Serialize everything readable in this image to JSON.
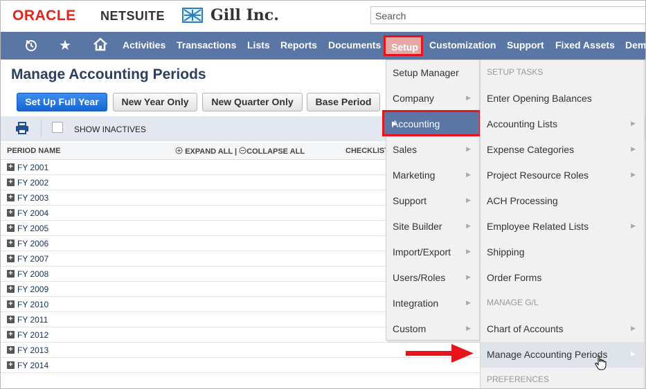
{
  "header": {
    "brand_oracle": "ORACLE",
    "brand_netsuite": "NETSUITE",
    "company_name": "Gill Inc.",
    "search_placeholder": "Search"
  },
  "nav": {
    "icons": [
      "recent-history-icon",
      "star-icon",
      "home-icon"
    ],
    "items": [
      "Activities",
      "Transactions",
      "Lists",
      "Reports",
      "Documents",
      "Setup",
      "Customization",
      "Support",
      "Fixed Assets",
      "Dem"
    ],
    "active": "Setup"
  },
  "page": {
    "title": "Manage Accounting Periods",
    "buttons": [
      "Set Up Full Year",
      "New Year Only",
      "New Quarter Only",
      "Base Period"
    ],
    "show_inactives": "SHOW INACTIVES",
    "table": {
      "col_period_name": "PERIOD NAME",
      "expand_all": "EXPAND ALL",
      "divider": "|",
      "collapse_all": "COLLAPSE ALL",
      "col_checklist": "CHECKLIST",
      "rows": [
        "FY 2001",
        "FY 2002",
        "FY 2003",
        "FY 2004",
        "FY 2005",
        "FY 2006",
        "FY 2007",
        "FY 2008",
        "FY 2009",
        "FY 2010",
        "FY 2011",
        "FY 2012",
        "FY 2013",
        "FY 2014"
      ]
    }
  },
  "setup_menu": {
    "items": [
      "Setup Manager",
      "Company",
      "Accounting",
      "Sales",
      "Marketing",
      "Support",
      "Site Builder",
      "Import/Export",
      "Users/Roles",
      "Integration",
      "Custom"
    ],
    "with_submenu": [
      false,
      true,
      true,
      true,
      true,
      true,
      true,
      true,
      true,
      true,
      true
    ],
    "selected": "Accounting"
  },
  "accounting_submenu": {
    "items": [
      {
        "label": "SETUP TASKS",
        "section": true,
        "arrow": false
      },
      {
        "label": "Enter Opening Balances",
        "section": false,
        "arrow": false
      },
      {
        "label": "Accounting Lists",
        "section": false,
        "arrow": true
      },
      {
        "label": "Expense Categories",
        "section": false,
        "arrow": true
      },
      {
        "label": "Project Resource Roles",
        "section": false,
        "arrow": true
      },
      {
        "label": "ACH Processing",
        "section": false,
        "arrow": false
      },
      {
        "label": "Employee Related Lists",
        "section": false,
        "arrow": true
      },
      {
        "label": "Shipping",
        "section": false,
        "arrow": false
      },
      {
        "label": "Order Forms",
        "section": false,
        "arrow": false
      },
      {
        "label": "MANAGE G/L",
        "section": true,
        "arrow": false
      },
      {
        "label": "Chart of Accounts",
        "section": false,
        "arrow": true
      },
      {
        "label": "Manage Accounting Periods",
        "section": false,
        "arrow": true
      },
      {
        "label": "PREFERENCES",
        "section": true,
        "arrow": false
      }
    ],
    "highlighted": "Manage Accounting Periods"
  },
  "colors": {
    "nav_bar": "#5a76a5",
    "highlight_box": "#e8141c",
    "primary_button": "#1567d2",
    "oracle_red": "#e2231a"
  }
}
